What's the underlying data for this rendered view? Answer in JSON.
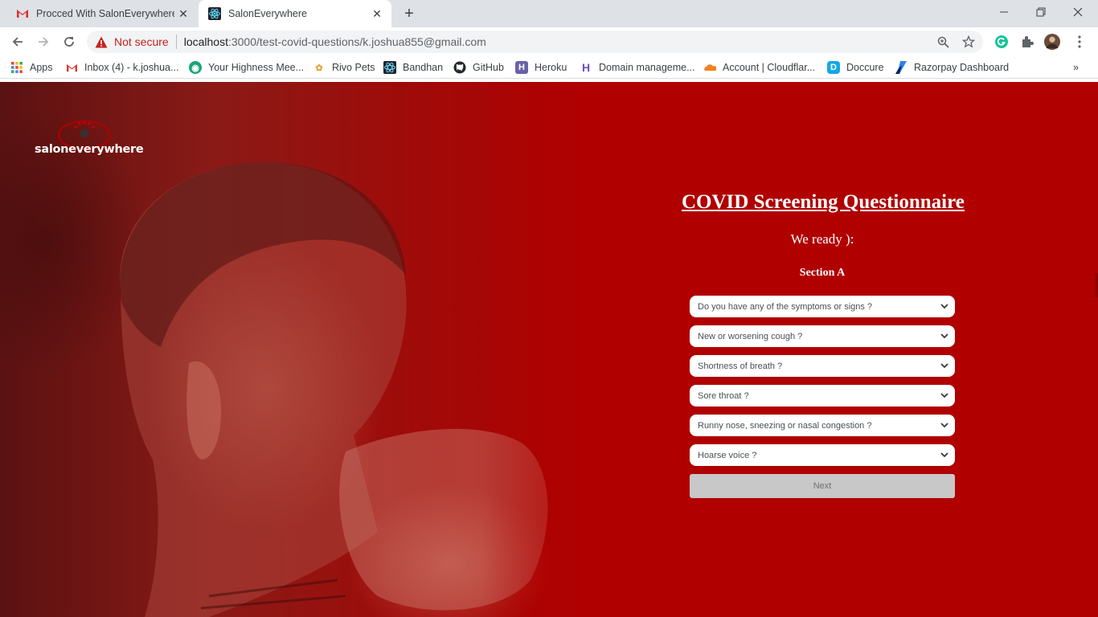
{
  "browser": {
    "tabs": [
      {
        "title": "Procced With SalonEverywhere -",
        "icon": "gmail-icon"
      },
      {
        "title": "SalonEverywhere",
        "icon": "react-icon"
      }
    ],
    "security_label": "Not secure",
    "url_host": "localhost",
    "url_path": ":3000/test-covid-questions/k.joshua855@gmail.com",
    "bookmarks": [
      {
        "label": "Apps"
      },
      {
        "label": "Inbox (4) - k.joshua..."
      },
      {
        "label": "Your Highness Mee..."
      },
      {
        "label": "Rivo Pets"
      },
      {
        "label": "Bandhan"
      },
      {
        "label": "GitHub"
      },
      {
        "label": "Heroku"
      },
      {
        "label": "Domain manageme..."
      },
      {
        "label": "Account | Cloudflar..."
      },
      {
        "label": "Doccure"
      },
      {
        "label": "Razorpay Dashboard"
      }
    ],
    "colors": {
      "tabbar": "#dee1e6",
      "warning": "#c5221f"
    }
  },
  "page": {
    "logo_text": "saloneverywhere",
    "title": "COVID Screening Questionnaire",
    "subtitle": "We ready ):",
    "section": "Section A",
    "questions": [
      {
        "placeholder": "Do you have any of the symptoms or signs ?"
      },
      {
        "placeholder": "New or worsening cough ?"
      },
      {
        "placeholder": "Shortness of breath ?"
      },
      {
        "placeholder": "Sore throat ?"
      },
      {
        "placeholder": "Runny nose, sneezing or nasal congestion ?"
      },
      {
        "placeholder": "Hoarse voice ?"
      }
    ],
    "next_label": "Next",
    "colors": {
      "background": "#b00000",
      "button": "#c8c8c8"
    }
  }
}
